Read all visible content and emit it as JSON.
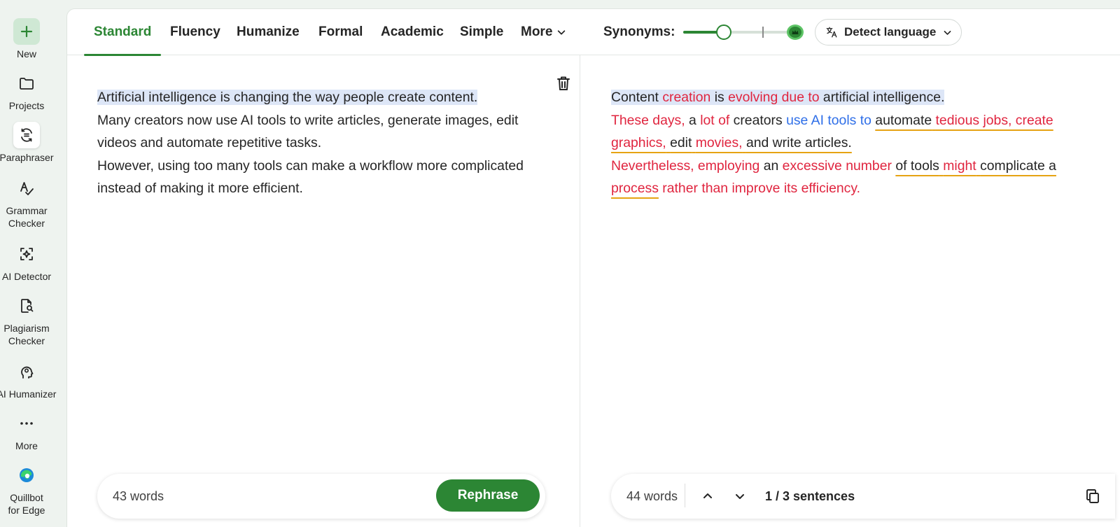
{
  "sidebar": {
    "items": [
      {
        "label": "New",
        "icon": "plus-icon"
      },
      {
        "label": "Projects",
        "icon": "folder-icon"
      },
      {
        "label": "Paraphraser",
        "icon": "paraphraser-icon"
      },
      {
        "label": "Grammar\nChecker",
        "icon": "grammar-icon"
      },
      {
        "label": "AI Detector",
        "icon": "ai-detector-icon"
      },
      {
        "label": "Plagiarism\nChecker",
        "icon": "plagiarism-icon"
      },
      {
        "label": "AI Humanizer",
        "icon": "humanizer-icon"
      },
      {
        "label": "More",
        "icon": "more-dots-icon"
      },
      {
        "label": "Quillbot\nfor Edge",
        "icon": "edge-icon"
      }
    ]
  },
  "modes": [
    "Standard",
    "Fluency",
    "Humanize",
    "Formal",
    "Academic",
    "Simple",
    "More"
  ],
  "active_mode": "Standard",
  "synonyms": {
    "label": "Synonyms:",
    "level": 0.35
  },
  "language": {
    "label": "Detect language"
  },
  "input": {
    "sentences": [
      "Artificial intelligence is changing the way people create content.",
      "Many creators now use AI tools to write articles, generate images, edit videos and automate repetitive tasks.",
      "However, using too many tools can make a workflow more complicated instead of making it more efficient."
    ],
    "word_count": "43 words",
    "rephrase_label": "Rephrase"
  },
  "output": {
    "s1": {
      "a": "Content ",
      "b": "creation",
      "c": " is ",
      "d": "evolving due to",
      "e": " artificial intelligence."
    },
    "s2": {
      "a": "These days,",
      "b": " a ",
      "c": "lot of",
      "d": " creators ",
      "e": "use AI tools to",
      "f": "automate",
      "g": "tedious jobs, create graphics,",
      "h": "edit",
      "i": "movies,",
      "j": "and write articles."
    },
    "s3": {
      "a": "Nevertheless, employing",
      "b": " an ",
      "c": "excessive number",
      "d": "of tools",
      "e": "might",
      "f": "complicate a",
      "g": "process",
      "h": "rather than improve its efficiency."
    },
    "word_count": "44 words",
    "sentence_counter": "1 / 3 sentences"
  },
  "colors": {
    "accent": "#2c8634",
    "changed": "#e0253f",
    "structural": "#2f6fe8",
    "highlight": "#dde6f7",
    "underline": "#e6a313"
  }
}
